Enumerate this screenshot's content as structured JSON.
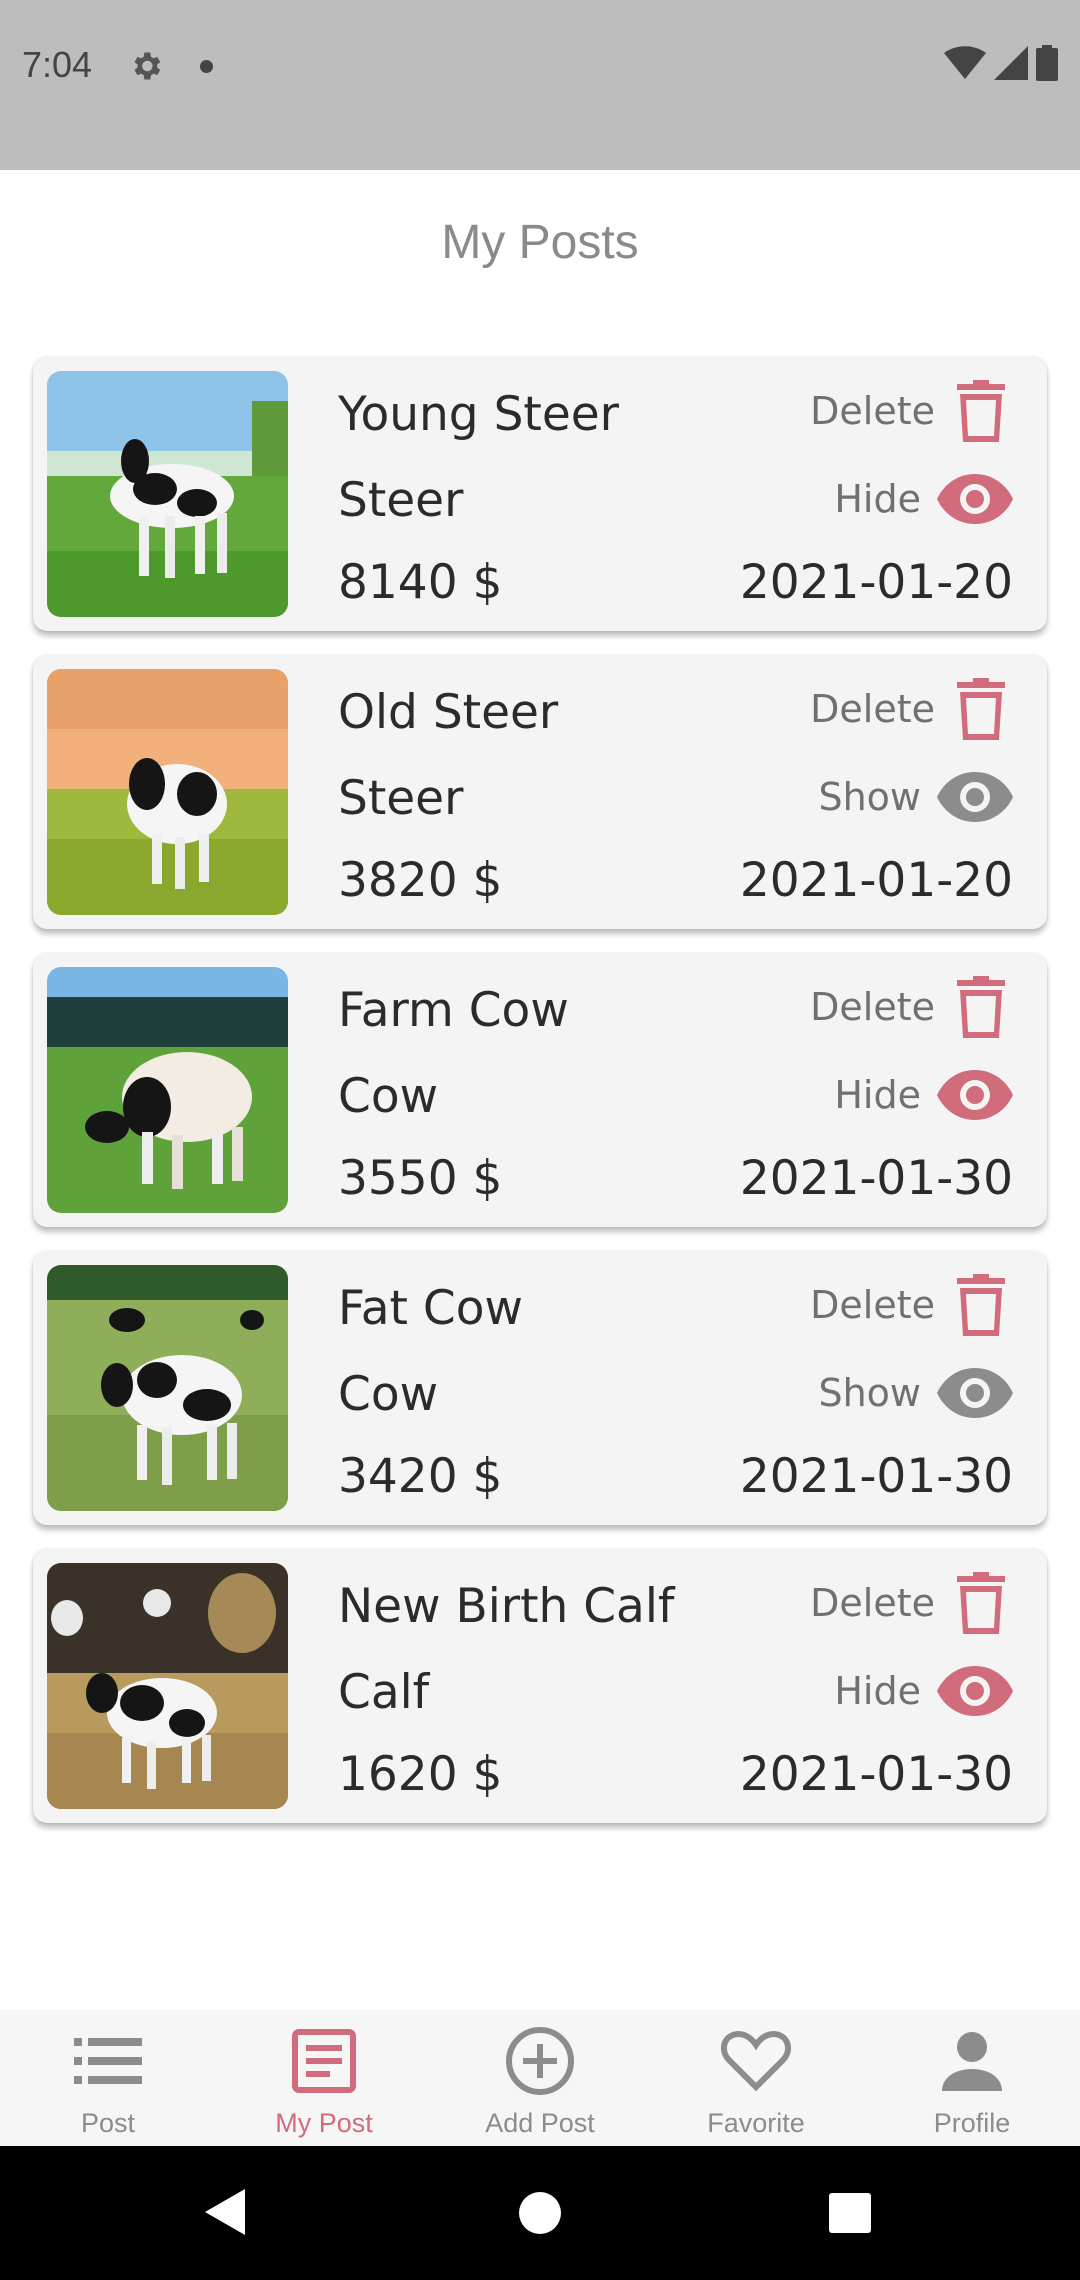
{
  "status_bar": {
    "time": "7:04"
  },
  "page": {
    "title": "My Posts"
  },
  "labels": {
    "delete": "Delete"
  },
  "posts": [
    {
      "title": "Young Steer",
      "category": "Steer",
      "price": "8140 $",
      "date": "2021-01-20",
      "visibility_label": "Hide",
      "visible": true
    },
    {
      "title": "Old Steer",
      "category": "Steer",
      "price": "3820 $",
      "date": "2021-01-20",
      "visibility_label": "Show",
      "visible": false
    },
    {
      "title": "Farm Cow",
      "category": "Cow",
      "price": "3550 $",
      "date": "2021-01-30",
      "visibility_label": "Hide",
      "visible": true
    },
    {
      "title": "Fat Cow",
      "category": "Cow",
      "price": "3420 $",
      "date": "2021-01-30",
      "visibility_label": "Show",
      "visible": false
    },
    {
      "title": "New Birth Calf",
      "category": "Calf",
      "price": "1620 $",
      "date": "2021-01-30",
      "visibility_label": "Hide",
      "visible": true
    }
  ],
  "bottom_nav": {
    "items": [
      {
        "label": "Post",
        "icon": "list-icon",
        "active": false
      },
      {
        "label": "My Post",
        "icon": "document-icon",
        "active": true
      },
      {
        "label": "Add Post",
        "icon": "add-circle-icon",
        "active": false
      },
      {
        "label": "Favorite",
        "icon": "heart-icon",
        "active": false
      },
      {
        "label": "Profile",
        "icon": "person-icon",
        "active": false
      }
    ]
  },
  "colors": {
    "accent": "#d06c7c",
    "inactive_icon": "#8c8c8c",
    "status_bar": "#bdbdbd"
  }
}
